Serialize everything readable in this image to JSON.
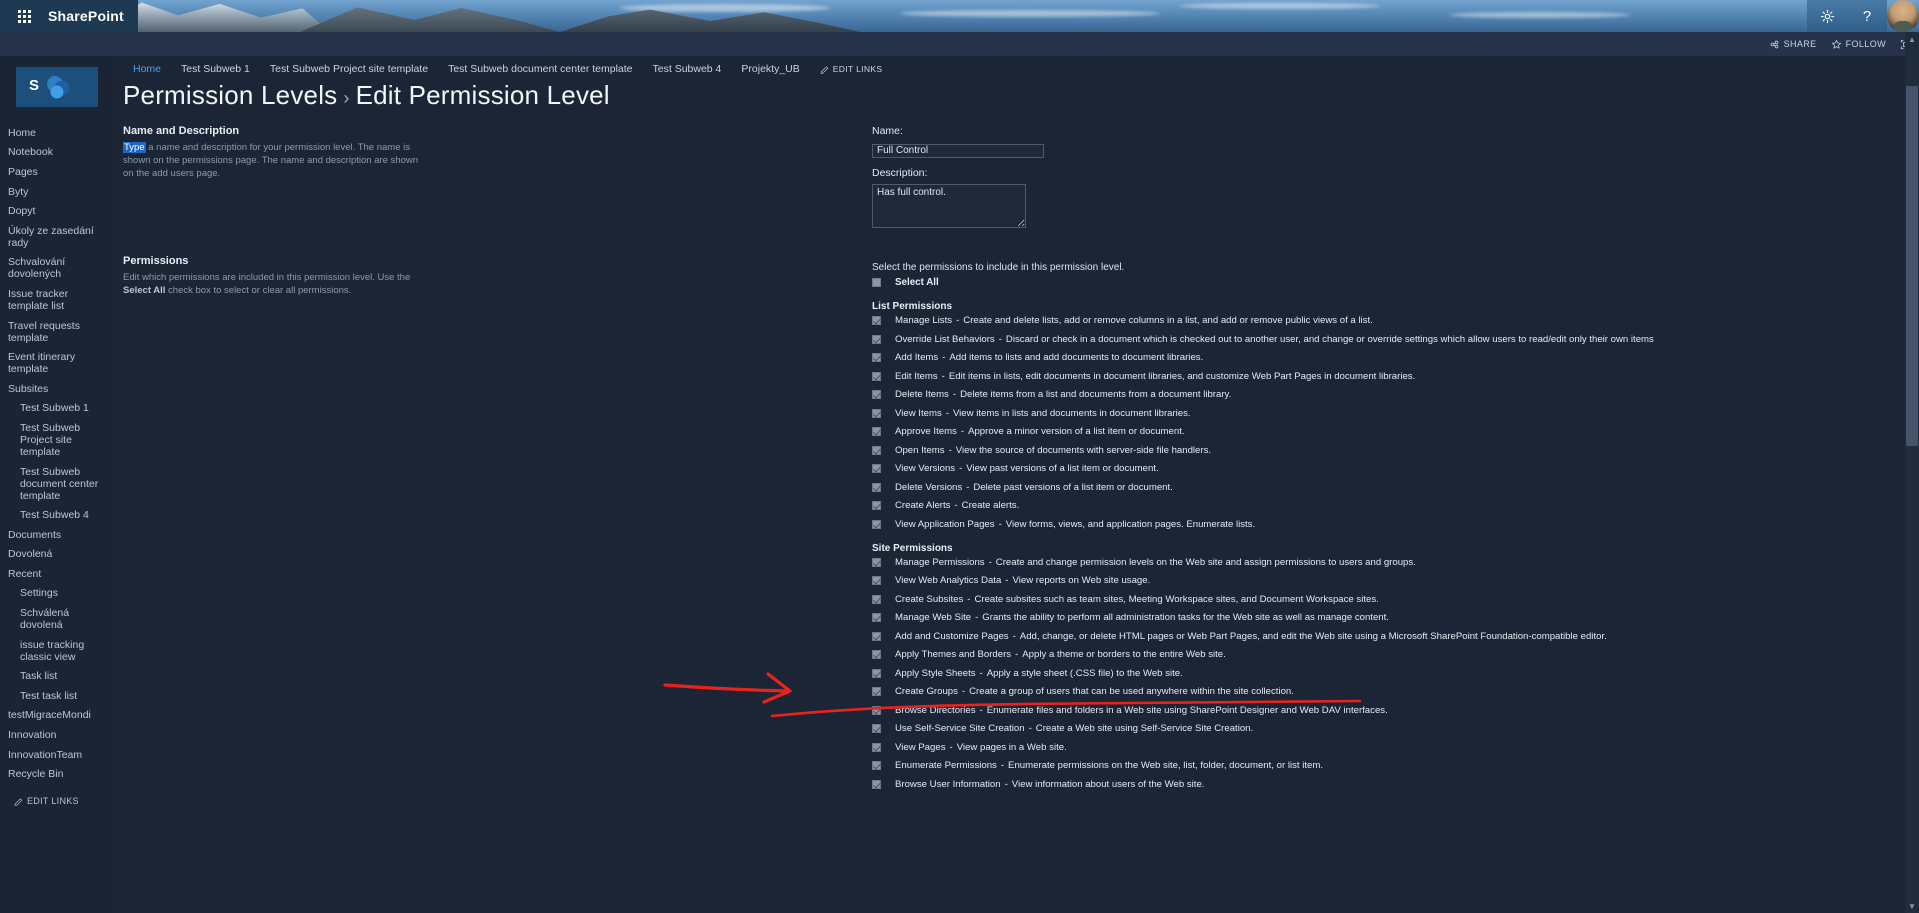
{
  "suite": {
    "brand": "SharePoint",
    "waffle_icon": "waffle-grid-icon",
    "settings_icon": "gear-icon",
    "help_icon": "help-icon",
    "avatar_icon": "user-avatar"
  },
  "command_bar": {
    "share_label": "SHARE",
    "follow_label": "FOLLOW",
    "share_icon": "share-icon",
    "follow_icon": "star-icon",
    "focus_icon": "focus-on-content-icon"
  },
  "rail": {
    "logo_letter": "S",
    "items": [
      {
        "label": "Home",
        "sub": false
      },
      {
        "label": "Notebook",
        "sub": false
      },
      {
        "label": "Pages",
        "sub": false
      },
      {
        "label": "Byty",
        "sub": false
      },
      {
        "label": "Dopyt",
        "sub": false
      },
      {
        "label": "Úkoly ze zasedání rady",
        "sub": false
      },
      {
        "label": "Schvalování dovolených",
        "sub": false
      },
      {
        "label": "Issue tracker template list",
        "sub": false
      },
      {
        "label": "Travel requests template",
        "sub": false
      },
      {
        "label": "Event itinerary template",
        "sub": false
      },
      {
        "label": "Subsites",
        "sub": false
      },
      {
        "label": "Test Subweb 1",
        "sub": true
      },
      {
        "label": "Test Subweb Project site template",
        "sub": true
      },
      {
        "label": "Test Subweb document center template",
        "sub": true
      },
      {
        "label": "Test Subweb 4",
        "sub": true
      },
      {
        "label": "Documents",
        "sub": false
      },
      {
        "label": "Dovolená",
        "sub": false
      },
      {
        "label": "Recent",
        "sub": false
      },
      {
        "label": "Settings",
        "sub": true
      },
      {
        "label": "Schválená dovolená",
        "sub": true
      },
      {
        "label": "issue tracking classic view",
        "sub": true
      },
      {
        "label": "Task list",
        "sub": true
      },
      {
        "label": "Test task list",
        "sub": true
      },
      {
        "label": "testMigraceMondi",
        "sub": false
      },
      {
        "label": "Innovation",
        "sub": false
      },
      {
        "label": "InnovationTeam",
        "sub": false
      },
      {
        "label": "Recycle Bin",
        "sub": false
      }
    ],
    "edit_links": "EDIT LINKS"
  },
  "top_nav": {
    "items": [
      {
        "label": "Home",
        "active": true
      },
      {
        "label": "Test Subweb 1",
        "active": false
      },
      {
        "label": "Test Subweb Project site template",
        "active": false
      },
      {
        "label": "Test Subweb document center template",
        "active": false
      },
      {
        "label": "Test Subweb 4",
        "active": false
      },
      {
        "label": "Projekty_UB",
        "active": false
      }
    ],
    "edit_links": "EDIT LINKS"
  },
  "page": {
    "title_primary": "Permission Levels",
    "title_separator": "›",
    "title_secondary": "Edit Permission Level"
  },
  "name_section": {
    "heading": "Name and Description",
    "desc_selected": "Type",
    "desc_rest": " a name and description for your permission level.  The name is shown on the permissions page.  The name and description are shown on the add users page.",
    "name_label": "Name:",
    "name_value": "Full Control",
    "description_label": "Description:",
    "description_value": "Has full control."
  },
  "permissions_section": {
    "heading": "Permissions",
    "desc_pre": "Edit which permissions are included in this permission level. Use the ",
    "desc_bold": "Select All",
    "desc_post": " check box to select or clear all permissions.",
    "intro": "Select the permissions to include in this permission level.",
    "select_all_label": "Select All",
    "select_all_checked": false,
    "groups": [
      {
        "name": "List Permissions",
        "items": [
          {
            "name": "Manage Lists",
            "desc": "Create and delete lists, add or remove columns in a list, and add or remove public views of a list.",
            "checked": true
          },
          {
            "name": "Override List Behaviors",
            "desc": "Discard or check in a document which is checked out to another user, and change or override settings which allow users to read/edit only their own items",
            "checked": true
          },
          {
            "name": "Add Items",
            "desc": "Add items to lists and add documents to document libraries.",
            "checked": true
          },
          {
            "name": "Edit Items",
            "desc": "Edit items in lists, edit documents in document libraries, and customize Web Part Pages in document libraries.",
            "checked": true
          },
          {
            "name": "Delete Items",
            "desc": "Delete items from a list and documents from a document library.",
            "checked": true
          },
          {
            "name": "View Items",
            "desc": "View items in lists and documents in document libraries.",
            "checked": true
          },
          {
            "name": "Approve Items",
            "desc": "Approve a minor version of a list item or document.",
            "checked": true
          },
          {
            "name": "Open Items",
            "desc": "View the source of documents with server-side file handlers.",
            "checked": true
          },
          {
            "name": "View Versions",
            "desc": "View past versions of a list item or document.",
            "checked": true
          },
          {
            "name": "Delete Versions",
            "desc": "Delete past versions of a list item or document.",
            "checked": true
          },
          {
            "name": "Create Alerts",
            "desc": "Create alerts.",
            "checked": true
          },
          {
            "name": "View Application Pages",
            "desc": "View forms, views, and application pages. Enumerate lists.",
            "checked": true
          }
        ]
      },
      {
        "name": "Site Permissions",
        "items": [
          {
            "name": "Manage Permissions",
            "desc": "Create and change permission levels on the Web site and assign permissions to users and groups.",
            "checked": true
          },
          {
            "name": "View Web Analytics Data",
            "desc": "View reports on Web site usage.",
            "checked": true
          },
          {
            "name": "Create Subsites",
            "desc": "Create subsites such as team sites, Meeting Workspace sites, and Document Workspace sites.",
            "checked": true
          },
          {
            "name": "Manage Web Site",
            "desc": "Grants the ability to perform all administration tasks for the Web site as well as manage content.",
            "checked": true,
            "annotated": true
          },
          {
            "name": "Add and Customize Pages",
            "desc": "Add, change, or delete HTML pages or Web Part Pages, and edit the Web site using a Microsoft SharePoint Foundation-compatible editor.",
            "checked": true
          },
          {
            "name": "Apply Themes and Borders",
            "desc": "Apply a theme or borders to the entire Web site.",
            "checked": true
          },
          {
            "name": "Apply Style Sheets",
            "desc": "Apply a style sheet (.CSS file) to the Web site.",
            "checked": true
          },
          {
            "name": "Create Groups",
            "desc": "Create a group of users that can be used anywhere within the site collection.",
            "checked": true
          },
          {
            "name": "Browse Directories",
            "desc": "Enumerate files and folders in a Web site using SharePoint Designer and Web DAV interfaces.",
            "checked": true
          },
          {
            "name": "Use Self-Service Site Creation",
            "desc": "Create a Web site using Self-Service Site Creation.",
            "checked": true
          },
          {
            "name": "View Pages",
            "desc": "View pages in a Web site.",
            "checked": true
          },
          {
            "name": "Enumerate Permissions",
            "desc": "Enumerate permissions on the Web site, list, folder, document, or list item.",
            "checked": true
          },
          {
            "name": "Browse User Information",
            "desc": "View information about users of the Web site.",
            "checked": true
          }
        ]
      }
    ]
  },
  "annotation": {
    "color": "#e8231e",
    "target": "Manage Web Site"
  }
}
